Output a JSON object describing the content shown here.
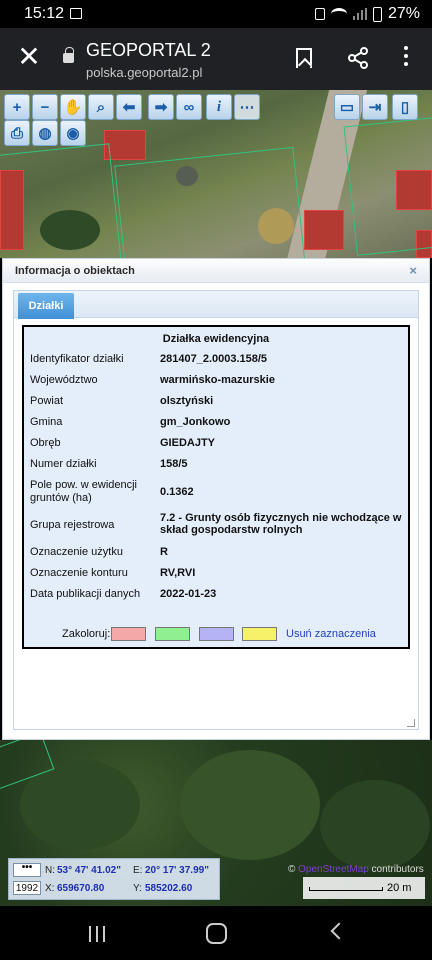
{
  "status_bar": {
    "time": "15:12",
    "battery": "27%"
  },
  "browser": {
    "title": "GEOPORTAL 2",
    "url": "polska.geoportal2.pl"
  },
  "toolbar": {
    "icons": [
      "zoom-in-icon",
      "zoom-out-icon",
      "pan-hand-icon",
      "zoom-area-icon",
      "back-arrow-icon",
      "forward-arrow-icon",
      "link-icon",
      "info-icon",
      "measure-icon",
      "print-icon",
      "globe-icon",
      "target-icon",
      "window-icon",
      "export-icon",
      "sidebar-icon"
    ],
    "info_glyph": "i"
  },
  "panel": {
    "title": "Informacja o obiektach",
    "close": "×",
    "tab": "Działki",
    "card_title": "Działka ewidencyjna",
    "rows": [
      {
        "label": "Identyfikator działki",
        "value": "281407_2.0003.158/5"
      },
      {
        "label": "Województwo",
        "value": "warmińsko-mazurskie"
      },
      {
        "label": "Powiat",
        "value": "olsztyński"
      },
      {
        "label": "Gmina",
        "value": "gm_Jonkowo"
      },
      {
        "label": "Obręb",
        "value": "GIEDAJTY"
      },
      {
        "label": "Numer działki",
        "value": "158/5"
      },
      {
        "label": "Pole pow. w ewidencji gruntów (ha)",
        "value": "0.1362"
      },
      {
        "label": "Grupa rejestrowa",
        "value": "7.2 - Grunty osób fizycznych nie wchodzące w skład gospodarstw rolnych"
      },
      {
        "label": "Oznaczenie użytku",
        "value": "R"
      },
      {
        "label": "Oznaczenie konturu",
        "value": "RV,RVI"
      },
      {
        "label": "Data publikacji danych",
        "value": "2022-01-23"
      }
    ],
    "color_label": "Zakoloruj:",
    "swatch_colors": [
      "#f5a8a8",
      "#8ff08f",
      "#b3b3f5",
      "#f5f26a"
    ],
    "clear_link": "Usuń zaznaczenia"
  },
  "coords": {
    "dots": "•••",
    "epsg": "1992",
    "n_label": "N:",
    "n_value": "53° 47' 41.02\"",
    "e_label": "E:",
    "e_value": "20° 17' 37.99\"",
    "x_label": "X:",
    "x_value": "659670.80",
    "y_label": "Y:",
    "y_value": "585202.60"
  },
  "attribution": {
    "prefix": "©",
    "osm": "OpenStreetMap",
    "suffix": "contributors"
  },
  "scale_label": "20 m",
  "colors": {
    "accent": "#3f90d6",
    "parcel_line": "#31c27d",
    "coord_value": "#1d2eb0"
  }
}
